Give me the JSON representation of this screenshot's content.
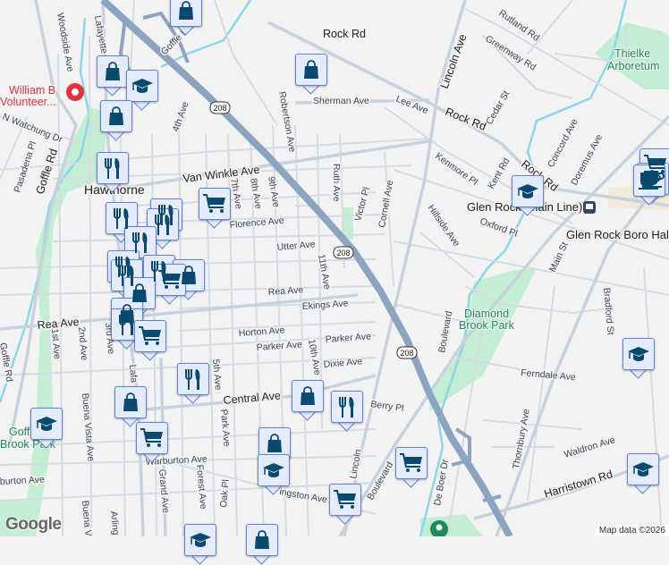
{
  "map": {
    "labels": {
      "rock_rd_1": "Rock Rd",
      "rock_rd_2": "Rock Rd",
      "rock_rd_3": "Rock Rd",
      "rutland_rd": "Rutland Rd",
      "greenway_rd": "Greenway Rd",
      "lincoln_ave": "Lincoln Ave",
      "lincoln_ave_s": "Lincoln",
      "sherman_ave": "Sherman Ave",
      "lee_ave": "Lee Ave",
      "cedar_st": "Cedar St",
      "kenmore_pl": "Kenmore Pl",
      "kent_rd": "Kent Rd",
      "concord_ave": "Concord Ave",
      "doremus_ave": "Doremus Ave",
      "ruth_ave": "Ruth Ave",
      "victor_pl": "Victor Pl",
      "cornell_ave": "Cornell Ave",
      "hillside_ave": "Hillside Ave",
      "oxford_pl": "Oxford Pl",
      "main_st": "Main St",
      "bradford_st": "Bradford St",
      "ferndale_ave": "Ferndale Ave",
      "thornbury_ave": "Thornbury Ave",
      "waldron_ave": "Waldron Ave",
      "harristown_rd": "Harristown Rd",
      "de_boer_dr": "De Boer Dr",
      "boulevard_1": "Boulevard",
      "boulevard_2": "Boulevard",
      "berry_pl": "Berry Pl",
      "robertson_ave": "Robertson Ave",
      "woodside_ave": "Woodside Ave",
      "lafayette_1": "Lafayette",
      "lafayette_2": "Lafa",
      "goffle_rd_1": "Goffle Rd",
      "goffle_rd_2": "Goffle Rd",
      "n_watchung_dr": "N Watchung Dr",
      "pasadena_pl": "Pasadena Pl",
      "fourth_ave": "4th Ave",
      "van_winkle_ave": "Van Winkle Ave",
      "seventh_ave": "7th Ave",
      "eighth_ave": "8th Ave",
      "ninth_ave": "9th Ave",
      "florence_ave": "Florence Ave",
      "utter_ave": "Utter Ave",
      "eleventh_ave": "11th Ave",
      "tenth_ave": "10th Ave",
      "rea_ave_1": "Rea Ave",
      "rea_ave_2": "Rea Ave",
      "ekings_ave": "Ekings Ave",
      "horton_ave": "Horton Ave",
      "parker_ave_1": "Parker Ave",
      "parker_ave_2": "Parker Ave",
      "dixie_ave": "Dixie Ave",
      "central_ave": "Central Ave",
      "first_ave": "1st Ave",
      "second_ave": "2nd Ave",
      "third_ave": "3rd Ave",
      "buena_vista_ave_1": "Buena Vista Ave",
      "buena_vista_ave_2": "Buena V",
      "fifth_ave": "5th Ave",
      "park_ave": "Park Ave",
      "warburton_ave_1": "Warburton Ave",
      "warburton_ave_2": "burton Ave",
      "grand_ave": "Grand Ave",
      "forest_ave": "Forest Ave",
      "oak_pl": "Oak Pl",
      "kingston_ave": "ingston Ave",
      "arlington": "Arling",
      "gorham": "Goffle Rd",
      "route_208_1": "208",
      "route_208_2": "208",
      "route_208_3": "208",
      "hawthorne": "Hawthorne",
      "glen_rock_station": "Glen Rock (Main Line)",
      "glen_rock_boro_hall": "Glen Rock Boro Hall",
      "thielke_1": "Thielke",
      "thielke_2": "Arboretum",
      "diamond_1": "Diamond",
      "diamond_2": "Brook Park",
      "goffle_park_1": "Goffle",
      "goffle_park_2": "Brook Park",
      "william_b_1": "William B",
      "william_b_2": "Volunteer..."
    },
    "attribution": "Map data ©2026",
    "logo": "Google",
    "colors": {
      "highway": "#8da4c0",
      "park": "#c3eed4",
      "water": "#8ad7ea",
      "marker_bg": "#e4ebfb",
      "marker_icon": "#0b4a6f",
      "poi_red": "#e0323c"
    }
  }
}
